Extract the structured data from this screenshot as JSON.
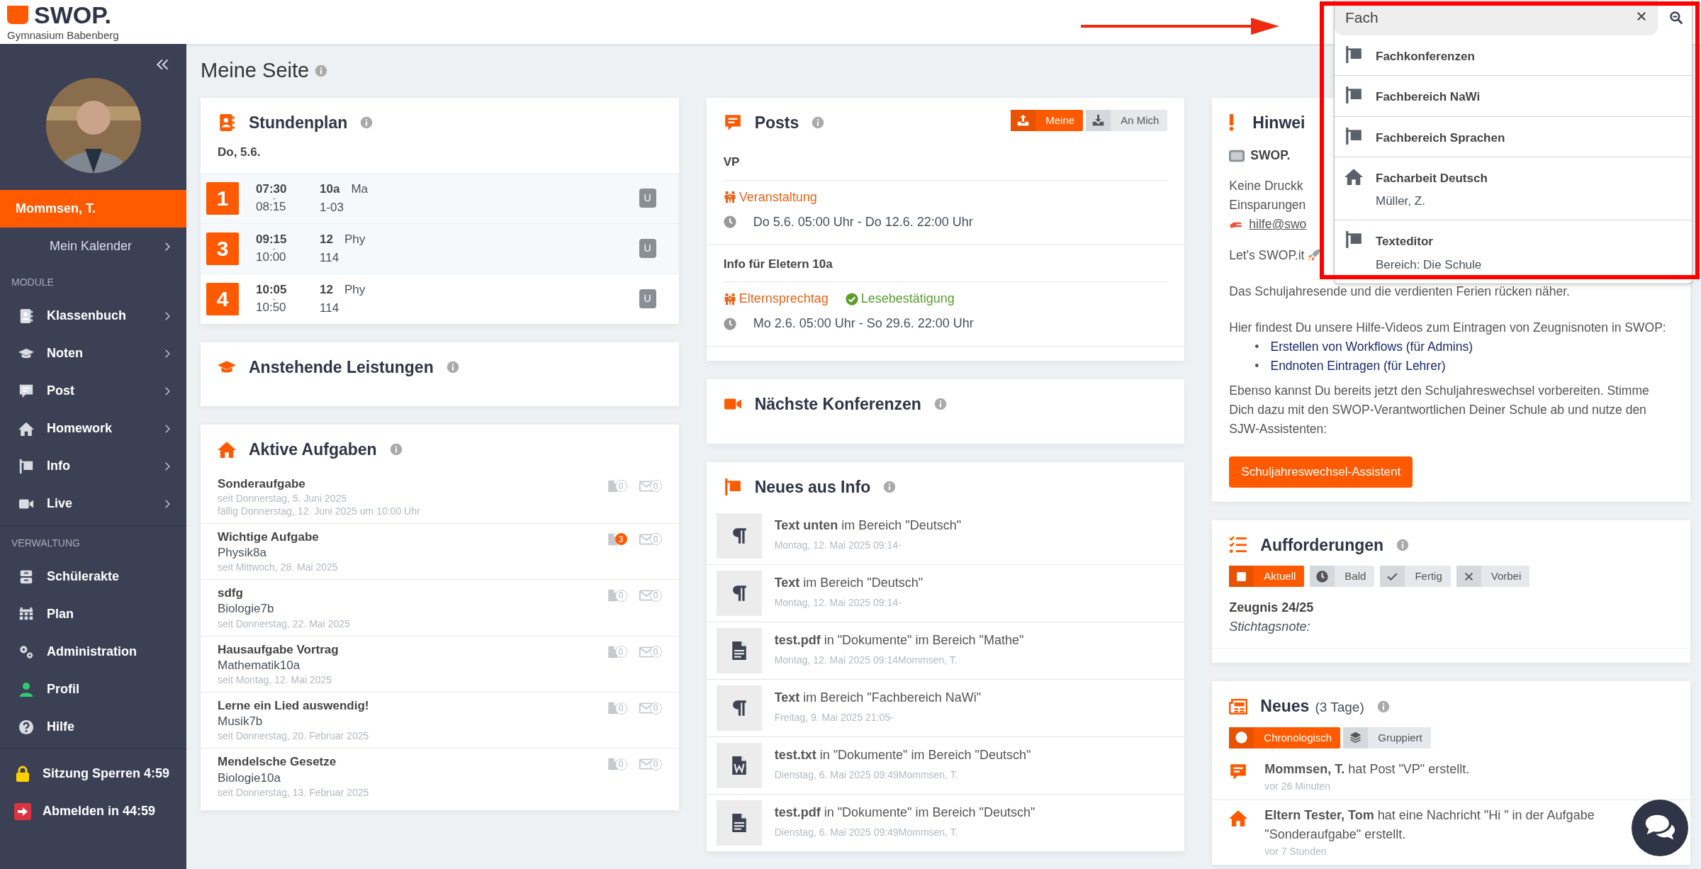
{
  "header": {
    "logo": "SWOP.",
    "school": "Gymnasium Babenberg"
  },
  "search": {
    "value": "Fach",
    "results": [
      {
        "kind": "info",
        "title": "Fachkonferenzen"
      },
      {
        "kind": "info",
        "title": "Fachbereich NaWi"
      },
      {
        "kind": "info",
        "title": "Fachbereich Sprachen"
      },
      {
        "kind": "homework",
        "title": "Facharbeit Deutsch",
        "subtitle": "Müller, Z."
      },
      {
        "kind": "info",
        "title": "Texteditor",
        "subtitle": "Bereich: Die Schule"
      }
    ]
  },
  "sidebar": {
    "user": "Mommsen, T.",
    "calendar": "Mein Kalender",
    "sections": [
      {
        "label": "MODULE",
        "items": [
          {
            "kind": "klassenbuch",
            "label": "Klassenbuch",
            "submenu": true
          },
          {
            "kind": "noten",
            "label": "Noten",
            "submenu": true
          },
          {
            "kind": "post",
            "label": "Post",
            "submenu": true
          },
          {
            "kind": "homework",
            "label": "Homework",
            "submenu": true
          },
          {
            "kind": "info",
            "label": "Info",
            "submenu": true
          },
          {
            "kind": "live",
            "label": "Live",
            "submenu": true
          }
        ]
      },
      {
        "label": "VERWALTUNG",
        "items": [
          {
            "kind": "akte",
            "label": "Schülerakte",
            "submenu": false
          },
          {
            "kind": "plan",
            "label": "Plan",
            "submenu": false
          },
          {
            "kind": "admin",
            "label": "Administration",
            "submenu": false
          },
          {
            "kind": "profil",
            "label": "Profil",
            "submenu": false
          },
          {
            "kind": "hilfe",
            "label": "Hilfe",
            "submenu": false
          }
        ]
      }
    ],
    "footer": [
      {
        "kind": "lock",
        "label": "Sitzung Sperren 4:59"
      },
      {
        "kind": "logout",
        "label": "Abmelden in 44:59"
      }
    ]
  },
  "page_title": "Meine Seite",
  "stundenplan": {
    "title": "Stundenplan",
    "date": "Do, 5.6.",
    "lessons": [
      {
        "period": "1",
        "start": "07:30",
        "dash": "-",
        "end": "08:15",
        "class": "10a",
        "subject": "Ma",
        "room": "1-03",
        "badge": "U"
      },
      {
        "period": "3",
        "start": "09:15",
        "dash": "-",
        "end": "10:00",
        "class": "12",
        "subject": "Phy",
        "room": "114",
        "badge": "U"
      },
      {
        "period": "4",
        "start": "10:05",
        "dash": "-",
        "end": "10:50",
        "class": "12",
        "subject": "Phy",
        "room": "114",
        "badge": "U"
      }
    ]
  },
  "leistungen": {
    "title": "Anstehende Leistungen"
  },
  "aufgaben": {
    "title": "Aktive Aufgaben",
    "items": [
      {
        "title": "Sonderaufgabe",
        "dates": [
          "seit Donnerstag, 5. Juni 2025",
          "fällig Donnerstag, 12. Juni 2025 um 10:00 Uhr"
        ],
        "files": "0",
        "unread": false,
        "messages": "0"
      },
      {
        "title": "Wichtige Aufgabe",
        "course": "Physik8a",
        "dates": [
          "seit Mittwoch, 28. Mai 2025"
        ],
        "files": "3",
        "unread": true,
        "messages": "0"
      },
      {
        "title": "sdfg",
        "course": "Biologie7b",
        "dates": [
          "seit Donnerstag, 22. Mai 2025"
        ],
        "files": "0",
        "unread": false,
        "messages": "0"
      },
      {
        "title": "Hausaufgabe Vortrag",
        "course": "Mathematik10a",
        "dates": [
          "seit Montag, 12. Mai 2025"
        ],
        "files": "0",
        "unread": false,
        "messages": "0"
      },
      {
        "title": "Lerne ein Lied auswendig!",
        "course": "Musik7b",
        "dates": [
          "seit Donnerstag, 20. Februar 2025"
        ],
        "files": "0",
        "unread": false,
        "messages": "0"
      },
      {
        "title": "Mendelsche Gesetze",
        "course": "Biologie10a",
        "dates": [
          "seit Donnerstag, 13. Februar 2025"
        ],
        "files": "0",
        "unread": false,
        "messages": "0"
      }
    ]
  },
  "posts": {
    "title": "Posts",
    "filters": [
      {
        "kind": "upload",
        "label": "Meine",
        "selected": true
      },
      {
        "kind": "download",
        "label": "An Mich",
        "selected": false
      }
    ],
    "items": [
      {
        "title": "VP",
        "tags": [
          {
            "kind": "event",
            "label": "Veranstaltung"
          }
        ],
        "time": "Do 5.6. 05:00 Uhr - Do 12.6. 22:00 Uhr"
      },
      {
        "title": "Info für Eletern 10a",
        "tags": [
          {
            "kind": "event",
            "label": "Elternsprechtag"
          },
          {
            "kind": "receipt",
            "label": "Lesebestätigung"
          }
        ],
        "time": "Mo 2.6. 05:00 Uhr - So 29.6. 22:00 Uhr"
      }
    ]
  },
  "konferenzen": {
    "title": "Nächste Konferenzen"
  },
  "info": {
    "title": "Neues aus Info",
    "items": [
      {
        "kind": "text",
        "text": "**Text unten** im Bereich \"Deutsch\"",
        "meta": "Montag, 12. Mai 2025 09:14-"
      },
      {
        "kind": "text",
        "text": "**Text** im Bereich \"Deutsch\"",
        "meta": "Montag, 12. Mai 2025 09:14-"
      },
      {
        "kind": "pdf",
        "text": "**test.pdf** in \"Dokumente\" im Bereich \"Mathe\"",
        "meta": "Montag, 12. Mai 2025 09:14Mommsen, T."
      },
      {
        "kind": "text",
        "text": "**Text** im Bereich \"Fachbereich NaWi\"",
        "meta": "Freitag, 9. Mai 2025 21:05-"
      },
      {
        "kind": "word",
        "text": "**test.txt** in \"Dokumente\" im Bereich \"Deutsch\"",
        "meta": "Dienstag, 6. Mai 2025 09:49Mommsen, T."
      },
      {
        "kind": "pdf",
        "text": "**test.pdf** in \"Dokumente\" im Bereich \"Deutsch\"",
        "meta": "Dienstag, 6. Mai 2025 09:49Mommsen, T."
      }
    ]
  },
  "hinweis": {
    "title": "Hinwei",
    "headline": "SWOP.",
    "lines": [
      "Keine Druckk",
      "Einsparungen"
    ],
    "mail": "hilfe@swo",
    "motto": "Let's SWOP.it",
    "paragraphs": [
      "Das Schuljahresende und die verdienten Ferien rücken näher.",
      "Hier findest Du unsere Hilfe-Videos zum Eintragen von Zeugnisnoten in SWOP:"
    ],
    "bullet": "•",
    "links": [
      "Erstellen von Workflows (für Admins)",
      "Endnoten Eintragen (für Lehrer)"
    ],
    "closing": "Ebenso kannst Du bereits jetzt den Schuljahreswechsel vorbereiten. Stimme Dich dazu mit den SWOP-Verantwortlichen Deiner Schule ab und nutze den SJW-Assistenten:",
    "button": "Schuljahreswechsel-Assistent"
  },
  "aufforderungen": {
    "title": "Aufforderungen",
    "filters": [
      {
        "kind": "current",
        "label": "Aktuell",
        "selected": true
      },
      {
        "kind": "soon",
        "label": "Bald",
        "selected": false
      },
      {
        "kind": "done",
        "label": "Fertig",
        "selected": false
      },
      {
        "kind": "past",
        "label": "Vorbei",
        "selected": false
      }
    ],
    "items": [
      {
        "title": "Zeugnis 24/25",
        "note": "Stichtagsnote:"
      }
    ]
  },
  "neues": {
    "title": "Neues",
    "period": "(3 Tage)",
    "filters": [
      {
        "kind": "chrono",
        "label": "Chronologisch",
        "selected": true
      },
      {
        "kind": "grouped",
        "label": "Gruppiert",
        "selected": false
      }
    ],
    "items": [
      {
        "kind": "post",
        "text": "**Mommsen, T.** hat Post \"VP\" erstellt.",
        "time": "vor 26 Minuten"
      },
      {
        "kind": "homework",
        "text": "**Eltern Tester, Tom** hat eine Nachricht \"Hi \" in der Aufgabe \"Sonderaufgabe\" erstellt.",
        "time": "vor 7 Stunden"
      }
    ]
  }
}
